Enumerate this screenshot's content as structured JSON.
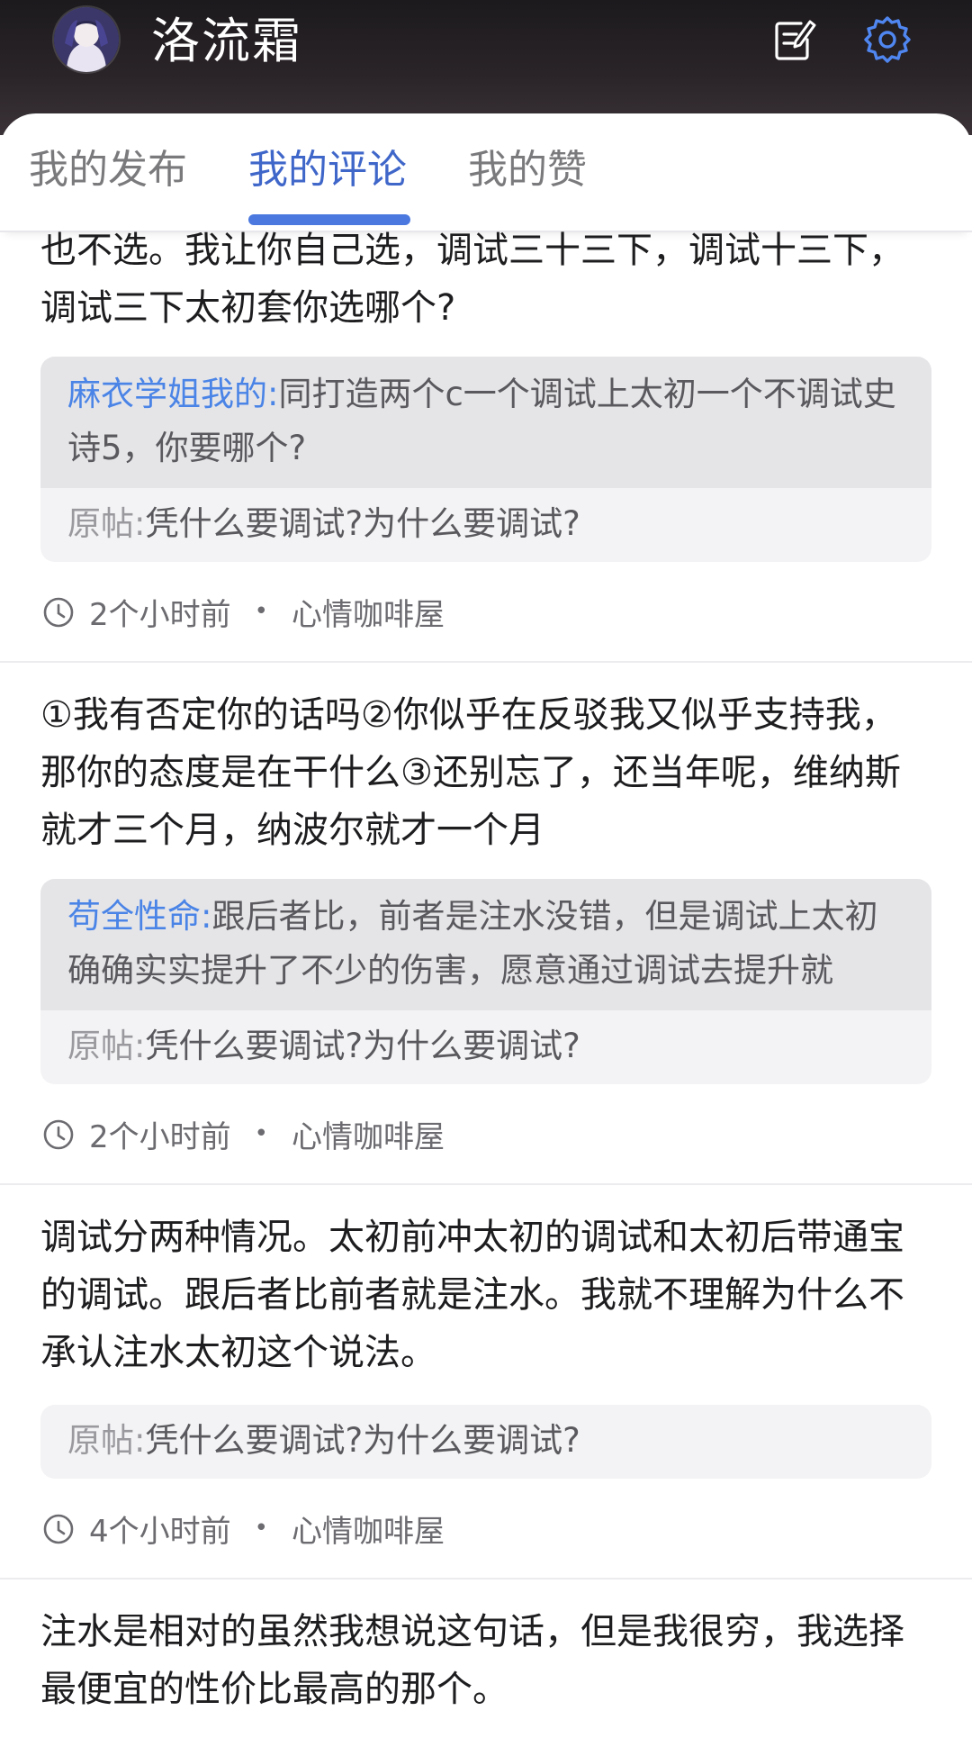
{
  "header": {
    "username": "洛流霜",
    "avatar_icon": "user-avatar",
    "edit_icon": "edit-note-icon",
    "settings_icon": "gear-icon"
  },
  "tabs": [
    {
      "label": "我的发布",
      "active": false
    },
    {
      "label": "我的评论",
      "active": true
    },
    {
      "label": "我的赞",
      "active": false
    }
  ],
  "comments": [
    {
      "text": "也不选。我让你自己选，调试三十三下，调试十三下，调试三下太初套你选哪个?",
      "reply_user": "麻衣学姐我的:",
      "reply_text": "同打造两个c一个调试上太初一个不调试史诗5，你要哪个?",
      "origin_label": "原帖:",
      "origin_text": "凭什么要调试?为什么要调试?",
      "time": "2个小时前",
      "board": "心情咖啡屋"
    },
    {
      "text": "①我有否定你的话吗②你似乎在反驳我又似乎支持我，那你的态度是在干什么③还别忘了，还当年呢，维纳斯就才三个月，纳波尔就才一个月",
      "reply_user": "苟全性命:",
      "reply_text": "跟后者比，前者是注水没错，但是调试上太初确确实实提升了不少的伤害，愿意通过调试去提升就",
      "origin_label": "原帖:",
      "origin_text": "凭什么要调试?为什么要调试?",
      "time": "2个小时前",
      "board": "心情咖啡屋"
    },
    {
      "text": "调试分两种情况。太初前冲太初的调试和太初后带通宝的调试。跟后者比前者就是注水。我就不理解为什么不承认注水太初这个说法。",
      "origin_label": "原帖:",
      "origin_text": "凭什么要调试?为什么要调试?",
      "time": "4个小时前",
      "board": "心情咖啡屋"
    },
    {
      "text": "注水是相对的虽然我想说这句话，但是我很穷，我选择最便宜的性价比最高的那个。"
    }
  ],
  "meta_separator": "•",
  "colors": {
    "accent": "#4a78df",
    "reply_user": "#4a84e6",
    "header_bg": "#1f1c1f"
  }
}
